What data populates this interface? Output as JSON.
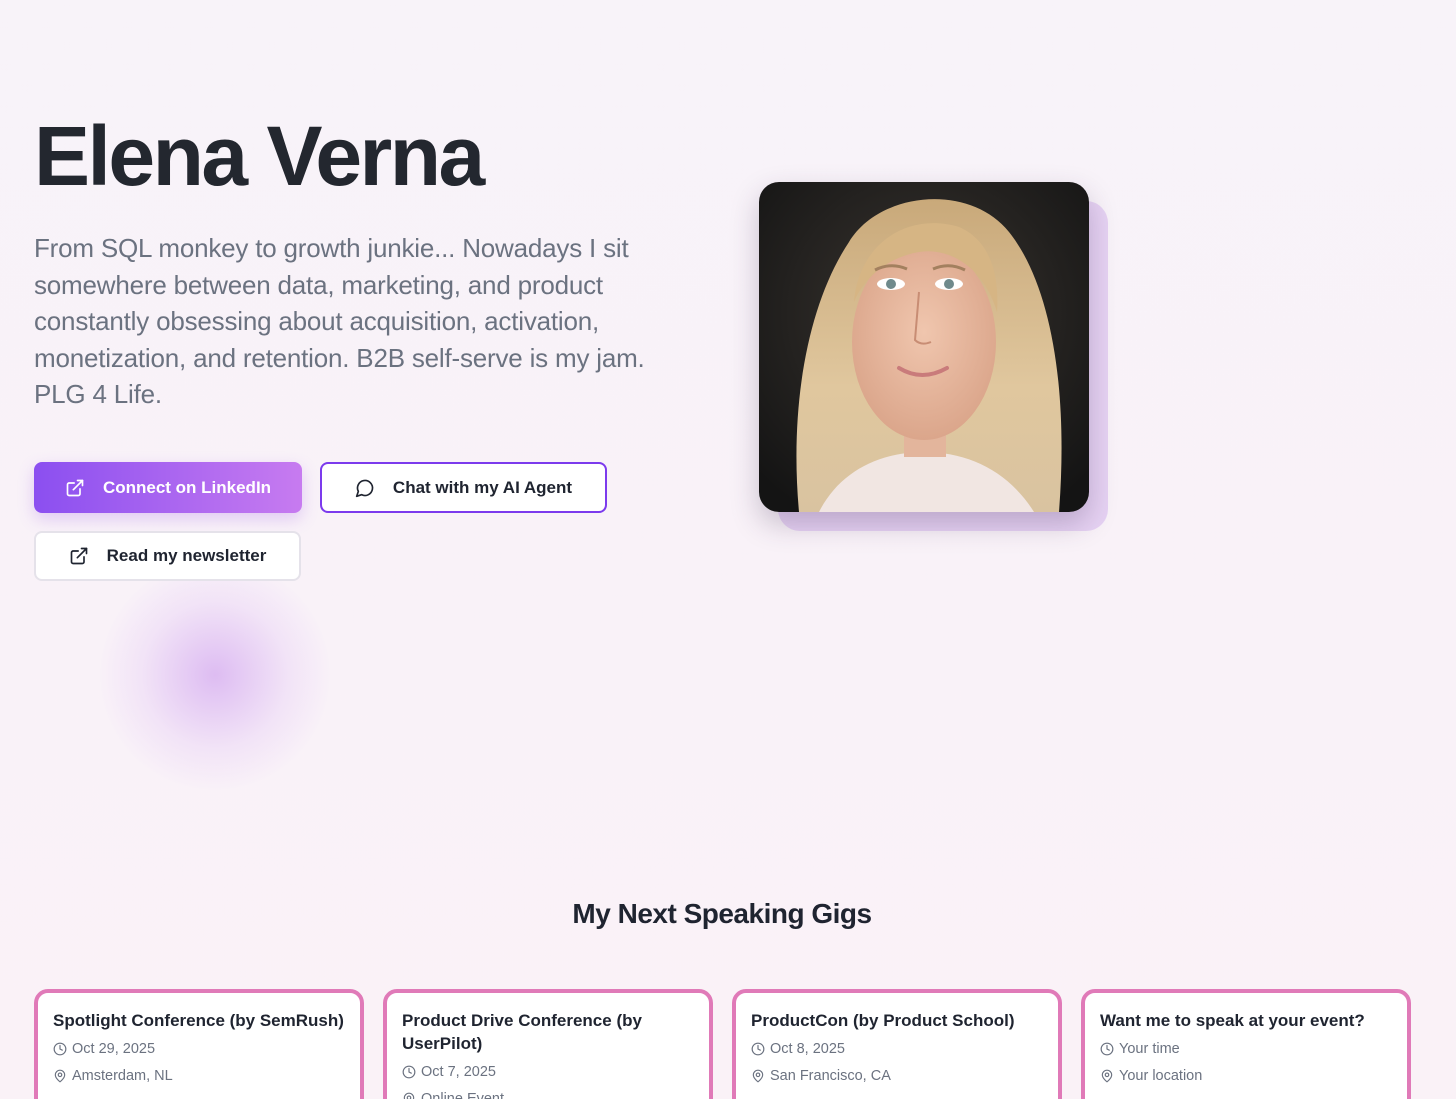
{
  "hero": {
    "name": "Elena Verna",
    "bio": "From SQL monkey to growth junkie... Nowadays I sit somewhere between data, marketing, and product constantly obsessing about acquisition, activation, monetization, and retention. B2B self-serve is my jam. PLG 4 Life."
  },
  "buttons": {
    "linkedin": "Connect on LinkedIn",
    "chat": "Chat with my AI Agent",
    "newsletter": "Read my newsletter"
  },
  "gigs": {
    "title": "My Next Speaking Gigs",
    "items": [
      {
        "title": "Spotlight Conference (by SemRush)",
        "date": "Oct 29, 2025",
        "location": "Amsterdam, NL"
      },
      {
        "title": "Product Drive Conference (by UserPilot)",
        "date": "Oct 7, 2025",
        "location": "Online Event"
      },
      {
        "title": "ProductCon (by Product School)",
        "date": "Oct 8, 2025",
        "location": "San Francisco, CA"
      },
      {
        "title": "Want me to speak at your event?",
        "date": "Your time",
        "location": "Your location"
      }
    ]
  },
  "colors": {
    "accent": "#7c3aed",
    "card_border": "#e07ab8"
  },
  "icons": {
    "external_link": "external-link-icon",
    "chat": "chat-bubble-icon",
    "clock": "clock-icon",
    "location": "map-pin-icon"
  }
}
